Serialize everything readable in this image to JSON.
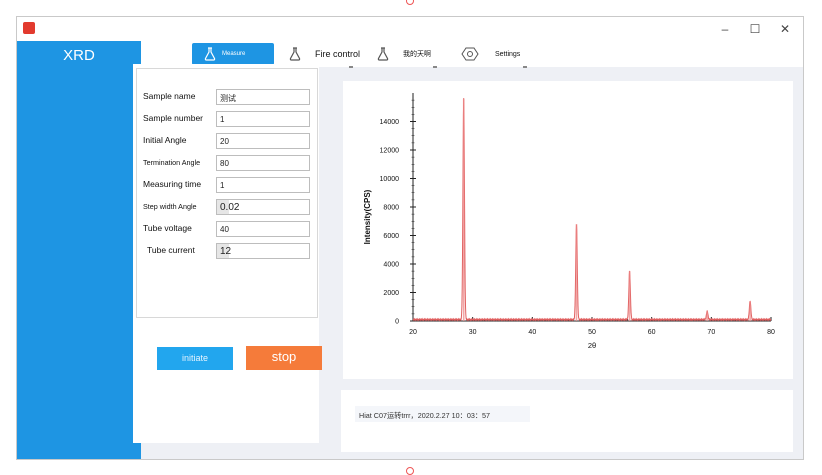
{
  "app": {
    "title": "XRD",
    "window_controls": [
      "–",
      "☐",
      "✕"
    ]
  },
  "nav": {
    "items": [
      {
        "label": "Measure",
        "icon": "flask-icon",
        "active": true
      },
      {
        "label": "Fire control",
        "icon": "flask-icon",
        "active": false
      },
      {
        "label": "我的天啊",
        "icon": "flask-icon",
        "active": false
      },
      {
        "label": "Settings",
        "icon": "gear-icon",
        "active": false
      }
    ]
  },
  "form": {
    "fields": [
      {
        "label": "Sample name",
        "value": "测试"
      },
      {
        "label": "Sample number",
        "value": "1"
      },
      {
        "label": "Initial Angle",
        "value": "20"
      },
      {
        "label": "Termination Angle",
        "value": "80"
      },
      {
        "label": "Measuring time",
        "value": "1"
      },
      {
        "label": "Step width Angle",
        "value": "0.02"
      },
      {
        "label": "Tube voltage",
        "value": "40"
      },
      {
        "label": "Tube current",
        "value": "12"
      }
    ]
  },
  "buttons": {
    "initiate": "initiate",
    "stop": "stop"
  },
  "log": {
    "message": "Hiat C07运转trrr，2020.2.27 10：03：57"
  },
  "colors": {
    "sidebar": "#1e95e3",
    "accent": "#1e95e3",
    "stop": "#f57b3a",
    "series": "#e06060"
  },
  "chart_data": {
    "type": "line",
    "title": "",
    "xlabel": "2θ",
    "ylabel": "Intensity(CPS)",
    "xlim": [
      20,
      80
    ],
    "ylim": [
      0,
      16000
    ],
    "x_ticks": [
      20,
      30,
      40,
      50,
      60,
      70,
      80
    ],
    "y_ticks": [
      0,
      2000,
      4000,
      6000,
      8000,
      10000,
      12000,
      14000
    ],
    "grid": false,
    "baseline": 100,
    "series": [
      {
        "peaks": [
          {
            "x": 28.5,
            "y": 15600
          },
          {
            "x": 47.4,
            "y": 6800
          },
          {
            "x": 56.3,
            "y": 3500
          },
          {
            "x": 69.3,
            "y": 700
          },
          {
            "x": 76.5,
            "y": 1400
          }
        ]
      }
    ]
  }
}
